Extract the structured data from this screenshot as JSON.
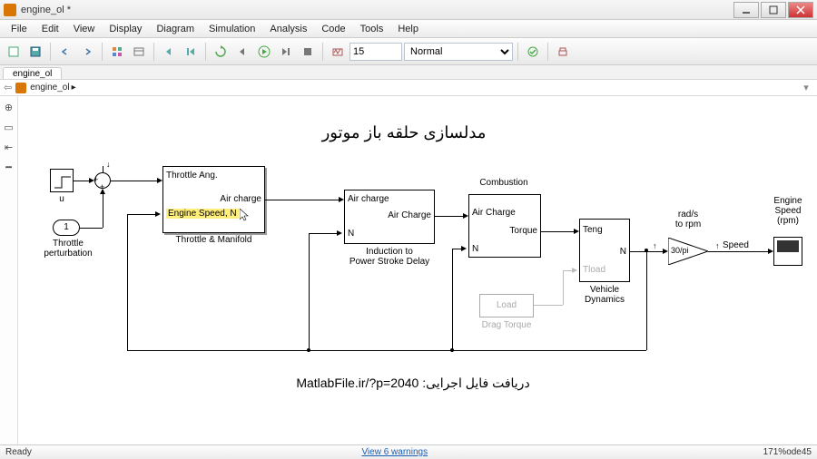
{
  "window": {
    "title": "engine_ol *"
  },
  "menu": {
    "file": "File",
    "edit": "Edit",
    "view": "View",
    "display": "Display",
    "diagram": "Diagram",
    "simulation": "Simulation",
    "analysis": "Analysis",
    "code": "Code",
    "tools": "Tools",
    "help": "Help"
  },
  "toolbar": {
    "stop_time": "15",
    "mode": "Normal"
  },
  "tabs": {
    "tab1": "engine_ol"
  },
  "breadcrumb": {
    "root": "engine_ol",
    "chev": "▸"
  },
  "diagram": {
    "title_fa": "مدلسازی حلقه باز موتور",
    "footer_fa": "دریافت فایل اجرایی:",
    "footer_link": "MatlabFile.ir/?p=2040",
    "labels": {
      "u": "u",
      "constant_1": "1",
      "throttle_pert": "Throttle\nperturbation",
      "throttle_ang": "Throttle Ang.",
      "engine_speed_n": "Engine Speed, N",
      "air_charge_out": "Air charge",
      "throttle_manifold": "Throttle & Manifold",
      "air_charge_in": "Air charge",
      "air_charge_out2": "Air Charge",
      "n_port": "N",
      "induction": "Induction to\nPower Stroke Delay",
      "combustion_title": "Combustion",
      "air_charge3": "Air Charge",
      "torque": "Torque",
      "n_port2": "N",
      "teng": "Teng",
      "tload": "Tload",
      "vd_n": "N",
      "vehicle_dynamics": "Vehicle\nDynamics",
      "load": "Load",
      "drag_torque": "Drag Torque",
      "gain": "30/pi",
      "rads_rpm": "rad/s\nto rpm",
      "speed": "Speed",
      "engine_speed_rpm": "Engine\nSpeed\n(rpm)"
    }
  },
  "status": {
    "ready": "Ready",
    "warnings": "View 6 warnings",
    "zoom": "171%",
    "solver": "ode45"
  }
}
